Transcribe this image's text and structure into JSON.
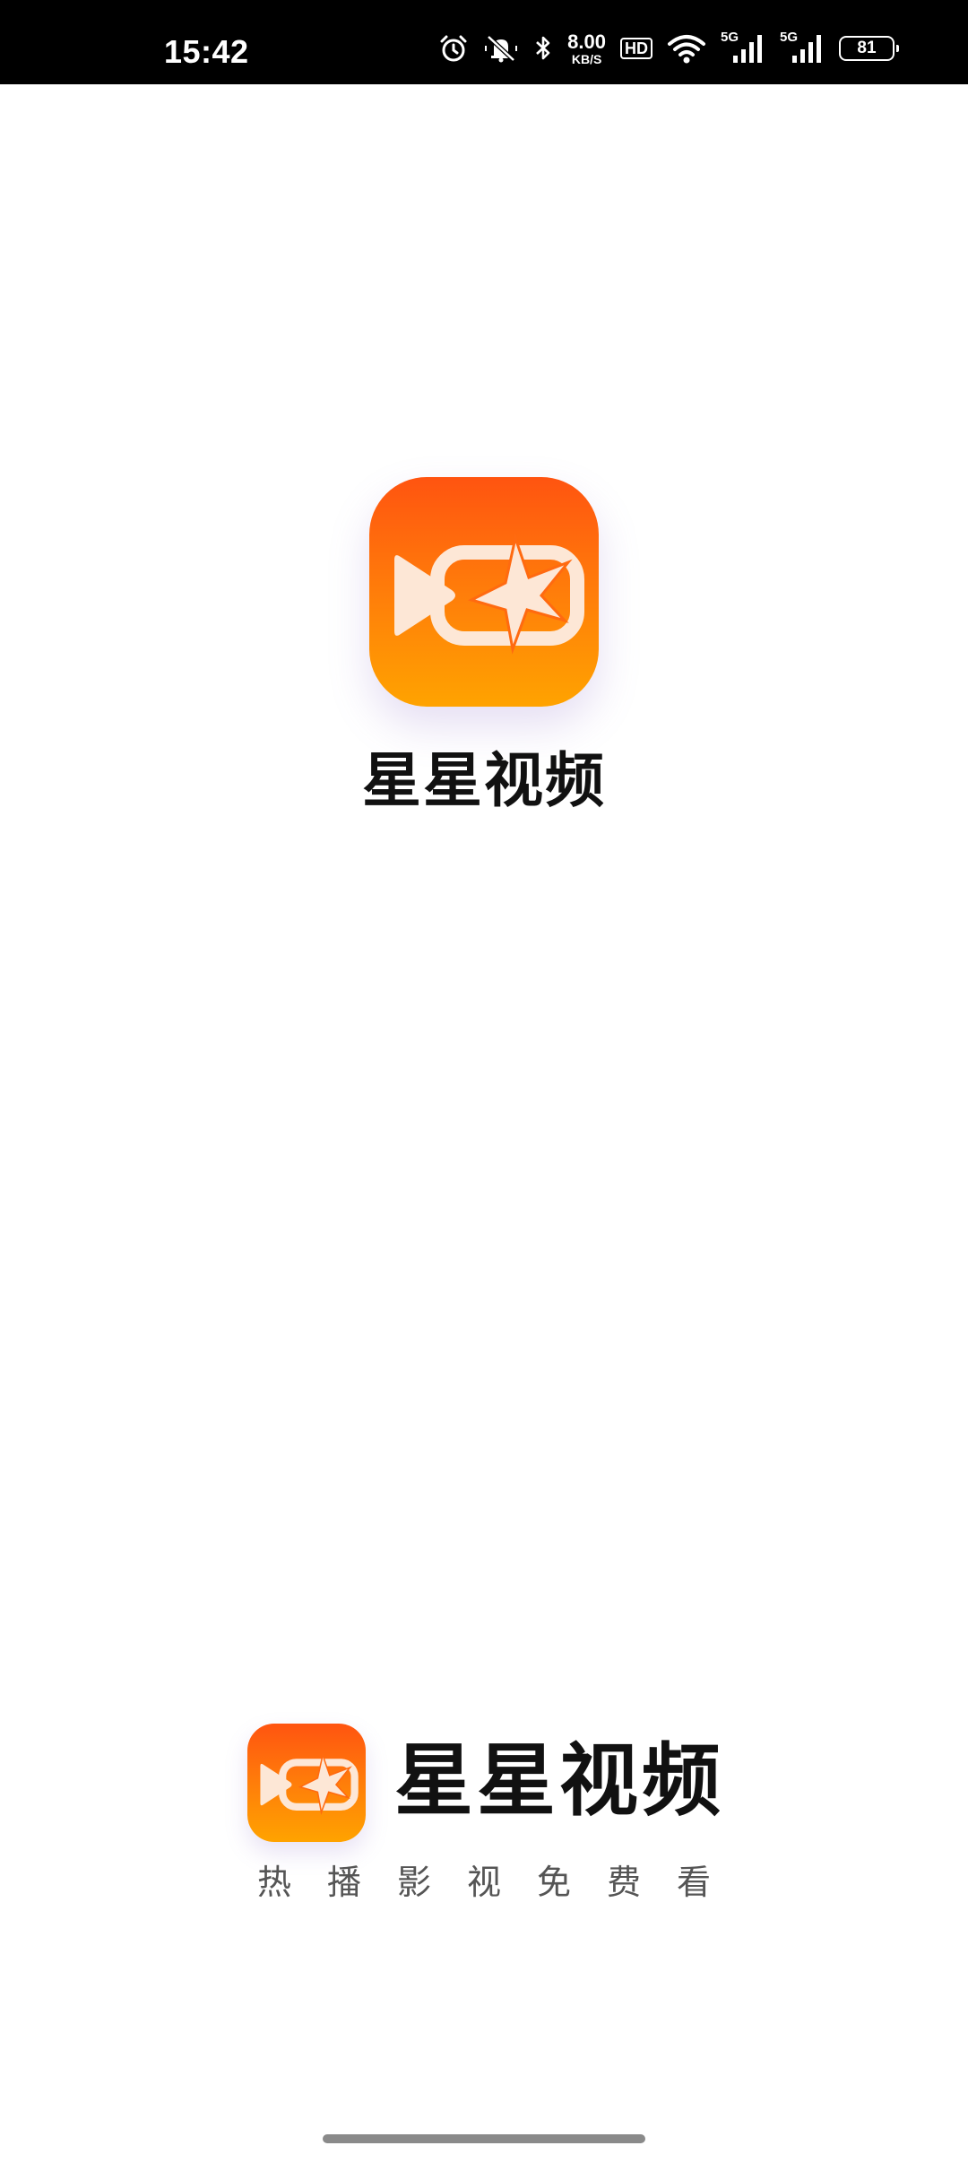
{
  "status_bar": {
    "time": "15:42",
    "network_speed": "8.00",
    "network_speed_unit": "KB/S",
    "hd_label": "HD",
    "signal_1_label": "5G",
    "signal_2_label": "5G",
    "battery_level": "81",
    "icons": [
      "alarm-icon",
      "mute-icon",
      "bluetooth-icon",
      "wifi-icon",
      "signal-icon",
      "signal-icon",
      "battery-icon"
    ]
  },
  "splash": {
    "app_name": "星星视频",
    "brand_name": "星星视频",
    "slogan": "热播影视免费看"
  },
  "colors": {
    "icon_gradient_top": "#ff5410",
    "icon_gradient_bottom": "#ffa300",
    "icon_glyph": "#fde7d6",
    "text_primary": "#111111",
    "text_secondary": "#555555",
    "status_bar_bg": "#000000"
  }
}
